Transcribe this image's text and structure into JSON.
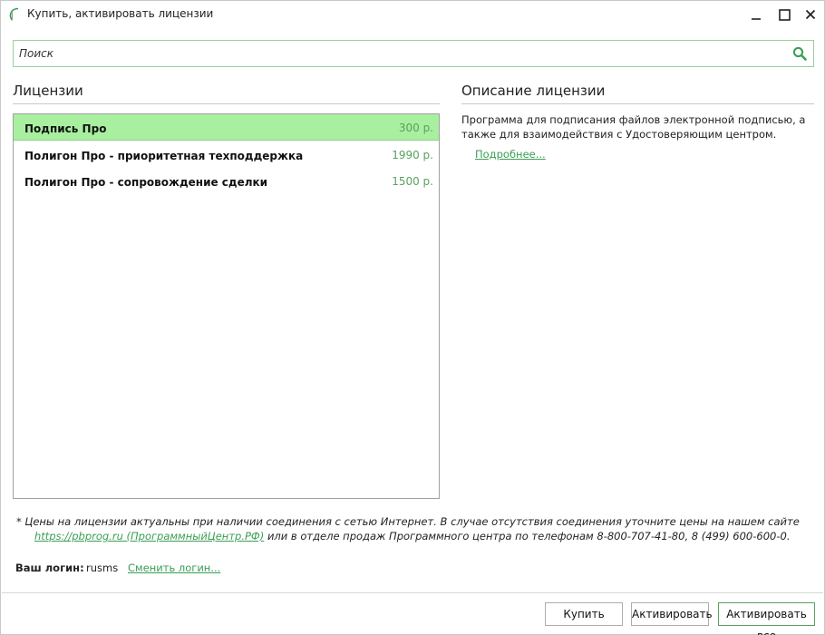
{
  "window": {
    "title": "Купить, активировать лицензии",
    "controls": {
      "minimize": "minimize-icon",
      "maximize": "maximize-icon",
      "close": "close-icon"
    }
  },
  "search": {
    "placeholder": "Поиск",
    "value": "",
    "icon": "search-icon"
  },
  "licenses": {
    "title": "Лицензии",
    "items": [
      {
        "name": "Подпись Про",
        "price": "300 р.",
        "selected": true
      },
      {
        "name": "Полигон Про - приоритетная техподдержка",
        "price": "1990 р."
      },
      {
        "name": "Полигон Про - сопровождение сделки",
        "price": "1500 р."
      }
    ]
  },
  "description": {
    "title": "Описание лицензии",
    "text": "Программа для подписания файлов электронной подписью, а также для взаимодействия с Удостоверяющим центром.",
    "more_link": "Подробнее..."
  },
  "note": {
    "line1": "* Цены на лицензии актуальны при наличии соединения с сетью Интернет. В случае отсутствия соединения уточните цены на нашем сайте",
    "link": "https://pbprog.ru (ПрограммныйЦентр.РФ)",
    "line2_rest": " или в отделе продаж Программного центра по телефонам 8-800-707-41-80, 8 (499) 600-600-0."
  },
  "login": {
    "label": "Ваш логин:",
    "value": "rusms",
    "change_link": "Сменить логин..."
  },
  "buttons": {
    "buy": "Купить",
    "activate": "Активировать",
    "activate_all": "Активировать все"
  },
  "colors": {
    "accent": "#3a9e55",
    "selected_row": "#a8f0a0",
    "price": "#5aa060"
  }
}
